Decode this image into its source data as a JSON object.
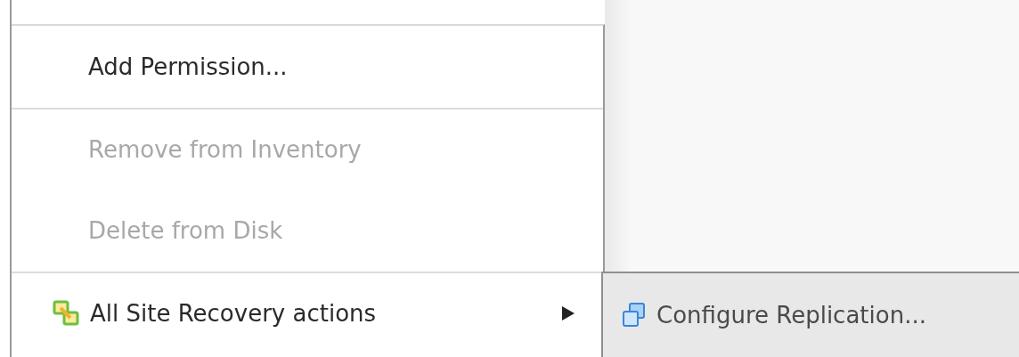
{
  "menu": {
    "items": [
      {
        "kind": "item",
        "label": "Add Permission...",
        "disabled": false
      },
      {
        "kind": "item",
        "label": "Remove from Inventory",
        "disabled": true
      },
      {
        "kind": "item",
        "label": "Delete from Disk",
        "disabled": true
      },
      {
        "kind": "submenu",
        "label": "All Site Recovery actions",
        "disabled": false,
        "expanded": true
      }
    ]
  },
  "submenu": {
    "items": [
      {
        "label": "Configure Replication...",
        "selected": true
      }
    ]
  }
}
